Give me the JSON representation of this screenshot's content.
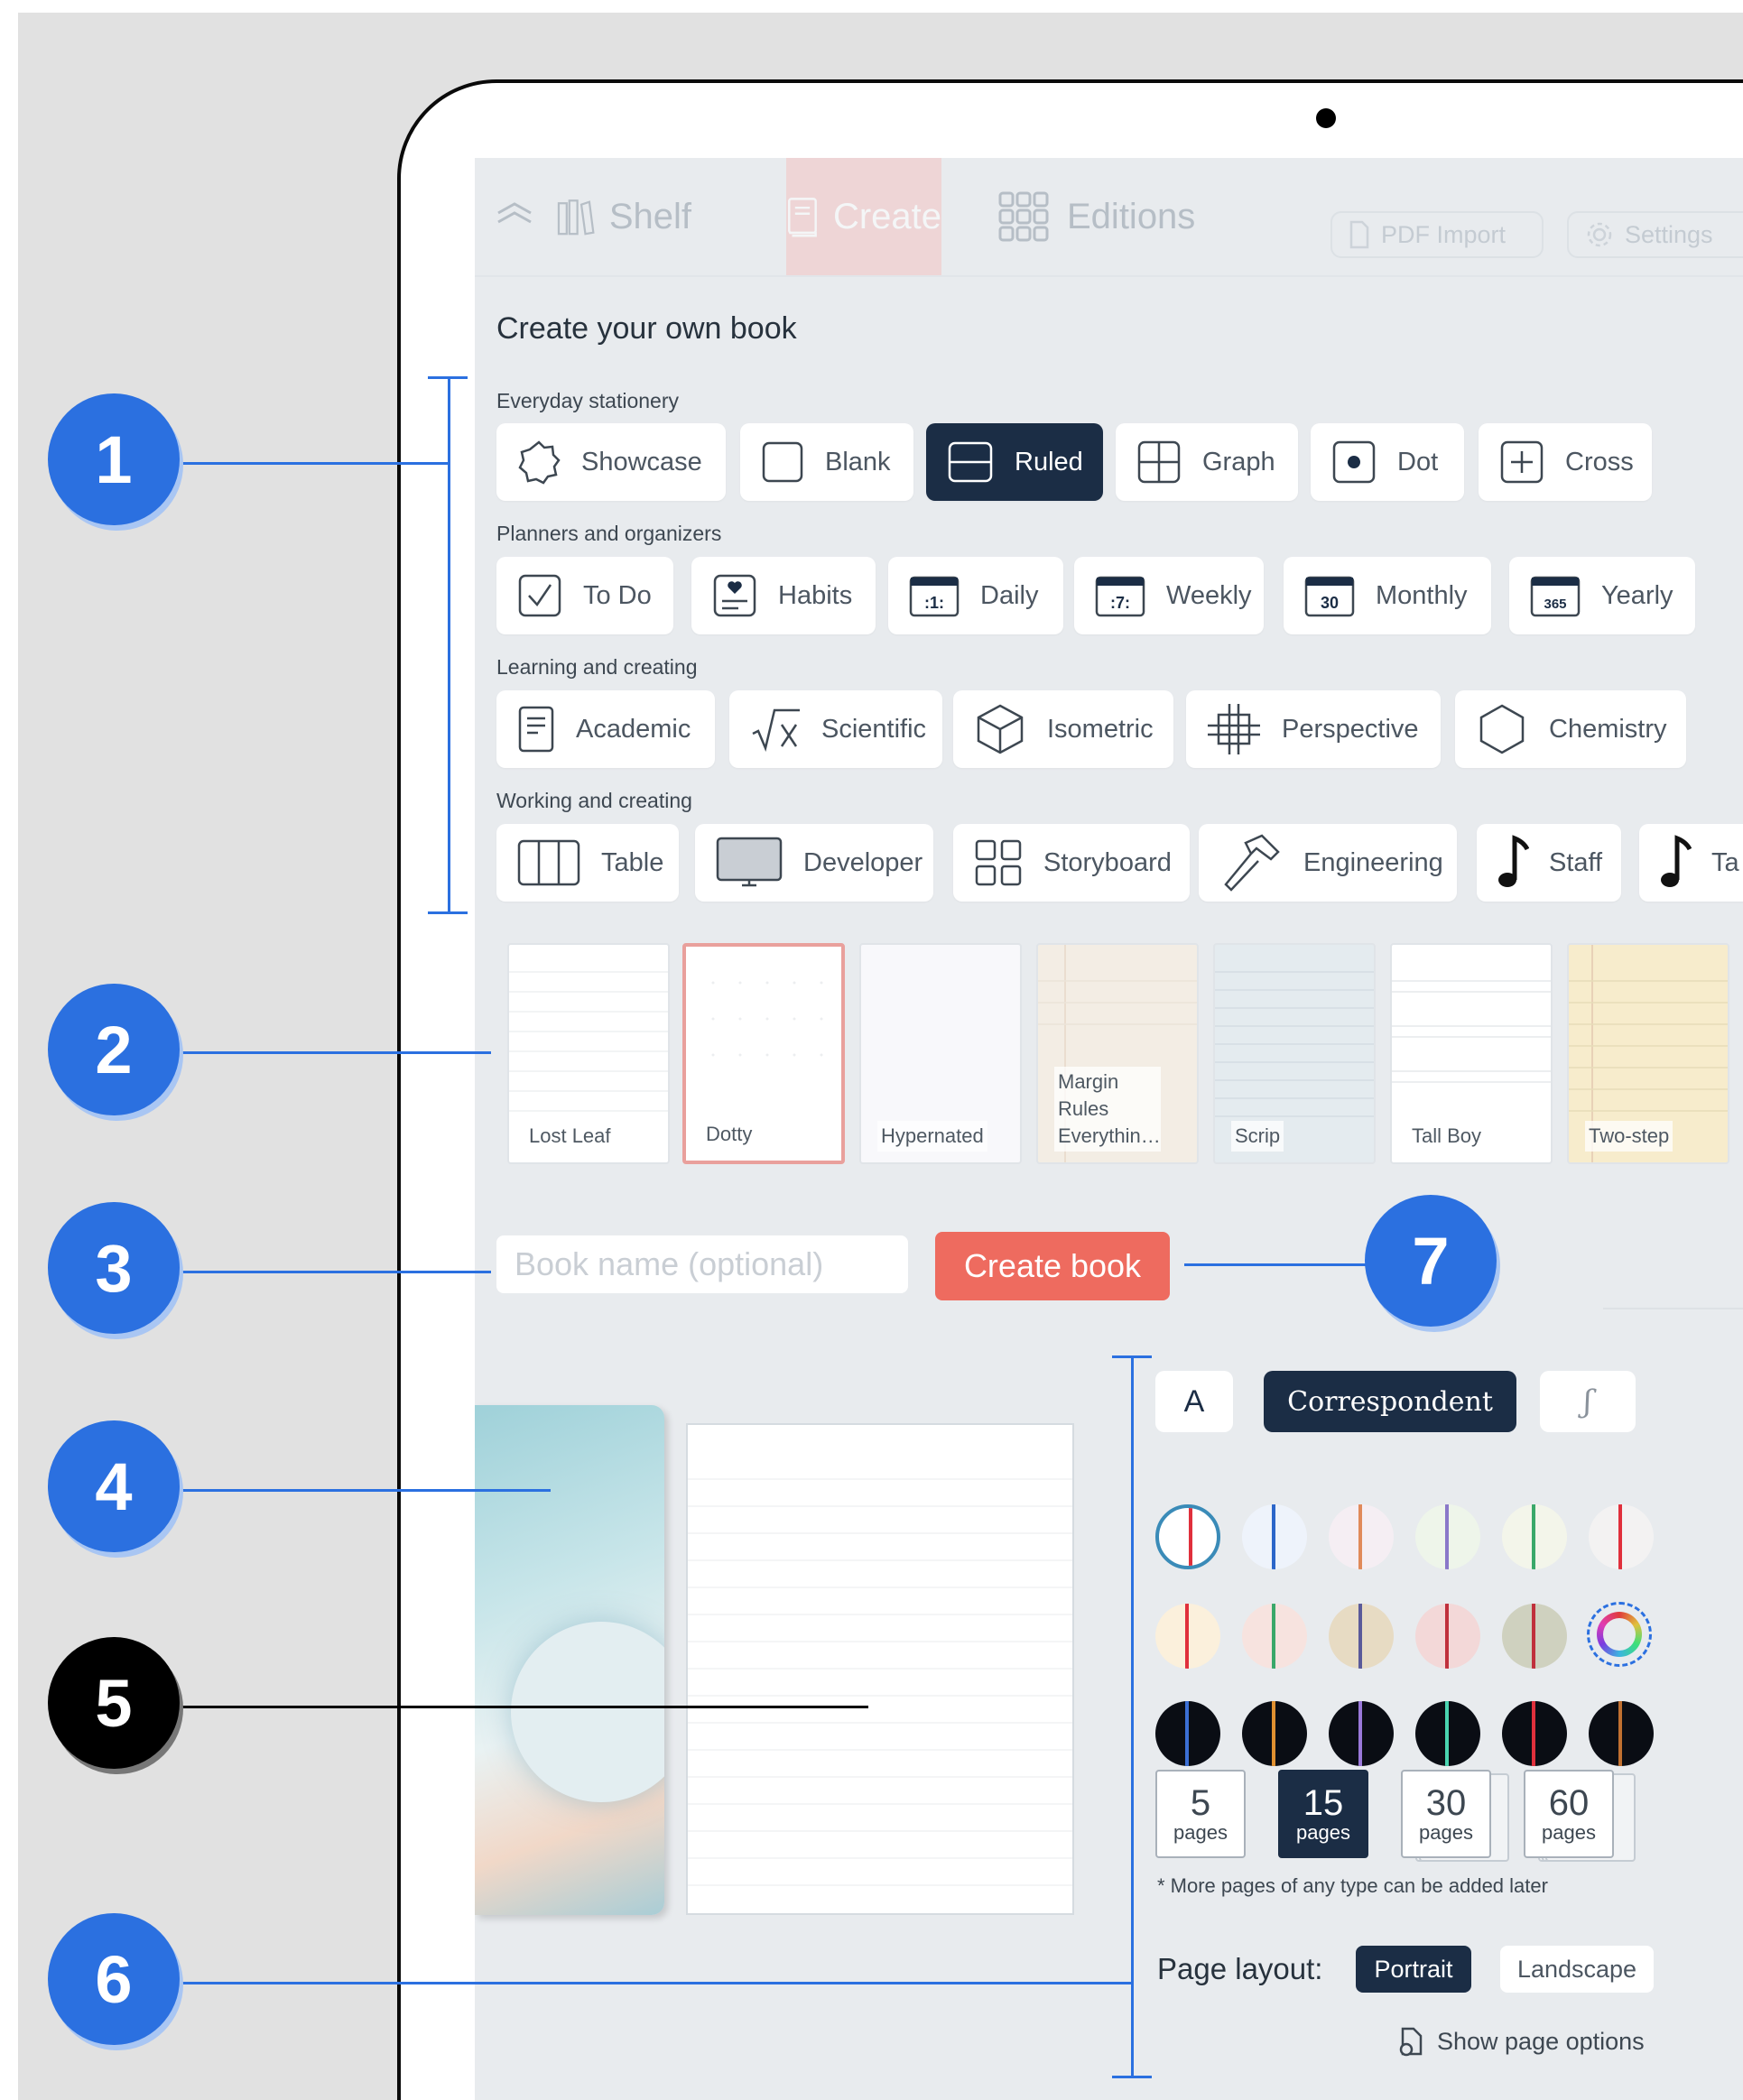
{
  "nav": {
    "shelf": "Shelf",
    "create": "Create",
    "editions": "Editions",
    "pdf_import": "PDF Import",
    "settings": "Settings"
  },
  "page_title": "Create your own book",
  "categories": {
    "everyday": "Everyday stationery",
    "planners": "Planners and organizers",
    "learning": "Learning and creating",
    "working": "Working and creating"
  },
  "everyday_items": [
    "Showcase",
    "Blank",
    "Ruled",
    "Graph",
    "Dot",
    "Cross"
  ],
  "planner_items": [
    "To Do",
    "Habits",
    "Daily",
    "Weekly",
    "Monthly",
    "Yearly"
  ],
  "planner_icon_numbers": [
    ":1:",
    ":7:",
    "30",
    "365"
  ],
  "learning_items": [
    "Academic",
    "Scientific",
    "Isometric",
    "Perspective",
    "Chemistry"
  ],
  "working_items": [
    "Table",
    "Developer",
    "Storyboard",
    "Engineering",
    "Staff",
    "Ta"
  ],
  "selected_template": "Ruled",
  "paper_styles": [
    "Lost Leaf",
    "Dotty",
    "Hypernated",
    "Margin Rules Everythin…",
    "Scrip",
    "Tall Boy",
    "Two-step"
  ],
  "selected_paper": "Dotty",
  "book_name": {
    "placeholder": "Book name (optional)",
    "value": ""
  },
  "create_button": "Create book",
  "font_options": [
    "A",
    "Correspondent",
    "ʃ"
  ],
  "selected_font": "Correspondent",
  "color_rows": [
    [
      {
        "bg": "#ffffff",
        "line": "#e0303c"
      },
      {
        "bg": "#eef3fb",
        "line": "#2c66c9"
      },
      {
        "bg": "#f5eef3",
        "line": "#e08a5a"
      },
      {
        "bg": "#eef5ea",
        "line": "#8a78c9"
      },
      {
        "bg": "#f3f5ea",
        "line": "#3aa86a"
      },
      {
        "bg": "#f3f2f2",
        "line": "#e0303c"
      }
    ],
    [
      {
        "bg": "#fbf0dc",
        "line": "#e0303c"
      },
      {
        "bg": "#f7e3df",
        "line": "#3aa86a"
      },
      {
        "bg": "#e7dbc3",
        "line": "#5a5a9a"
      },
      {
        "bg": "#f3d8d8",
        "line": "#c0303c"
      },
      {
        "bg": "#cfd1bf",
        "line": "#c0303c"
      }
    ],
    [
      {
        "bg": "#0a0d14",
        "line": "#3b6fd4"
      },
      {
        "bg": "#0a0d14",
        "line": "#e09030"
      },
      {
        "bg": "#0a0d14",
        "line": "#9a78d9"
      },
      {
        "bg": "#0a0d14",
        "line": "#4ad4b0"
      },
      {
        "bg": "#0a0d14",
        "line": "#e0303c"
      },
      {
        "bg": "#0a0d14",
        "line": "#c07030"
      }
    ]
  ],
  "page_counts": [
    {
      "n": "5",
      "u": "pages"
    },
    {
      "n": "15",
      "u": "pages"
    },
    {
      "n": "30",
      "u": "pages"
    },
    {
      "n": "60",
      "u": "pages"
    }
  ],
  "selected_pages": "15",
  "page_note": "* More pages of any type can be added later",
  "page_layout": {
    "label": "Page layout:",
    "portrait": "Portrait",
    "landscape": "Landscape",
    "selected": "Portrait"
  },
  "show_options": "Show page options",
  "callouts": [
    "1",
    "2",
    "3",
    "4",
    "5",
    "6",
    "7"
  ],
  "colors": {
    "accent": "#2b70e0",
    "create_button": "#ee6b5f",
    "selected_chip": "#1b2d45"
  }
}
